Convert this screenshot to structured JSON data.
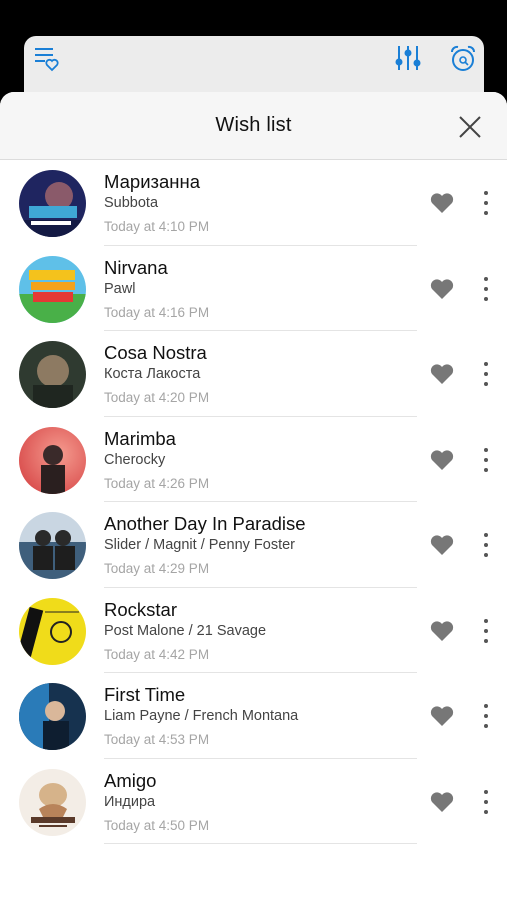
{
  "sheet": {
    "title": "Wish list"
  },
  "tracks": [
    {
      "title": "Маризанна",
      "artist": "Subbota",
      "time": "Today at 4:10 PM",
      "cover_color": "#2b2f6e"
    },
    {
      "title": "Nirvana",
      "artist": "Pawl",
      "time": "Today at 4:16 PM",
      "cover_color": "#f4c21c"
    },
    {
      "title": "Cosa Nostra",
      "artist": "Коста Лакоста",
      "time": "Today at 4:20 PM",
      "cover_color": "#3a4a3c"
    },
    {
      "title": "Marimba",
      "artist": "Cherocky",
      "time": "Today at 4:26 PM",
      "cover_color": "#e0706a"
    },
    {
      "title": "Another Day In Paradise",
      "artist": "Slider / Magnit / Penny Foster",
      "time": "Today at 4:29 PM",
      "cover_color": "#3f6c8c"
    },
    {
      "title": "Rockstar",
      "artist": "Post Malone / 21 Savage",
      "time": "Today at 4:42 PM",
      "cover_color": "#f0dc1a"
    },
    {
      "title": "First Time",
      "artist": "Liam Payne / French Montana",
      "time": "Today at 4:53 PM",
      "cover_color": "#1e5a8a"
    },
    {
      "title": "Amigo",
      "artist": "Индира",
      "time": "Today at 4:50 PM",
      "cover_color": "#f3ede6"
    }
  ],
  "colors": {
    "accent": "#1a7fd6",
    "heart": "#777777"
  }
}
